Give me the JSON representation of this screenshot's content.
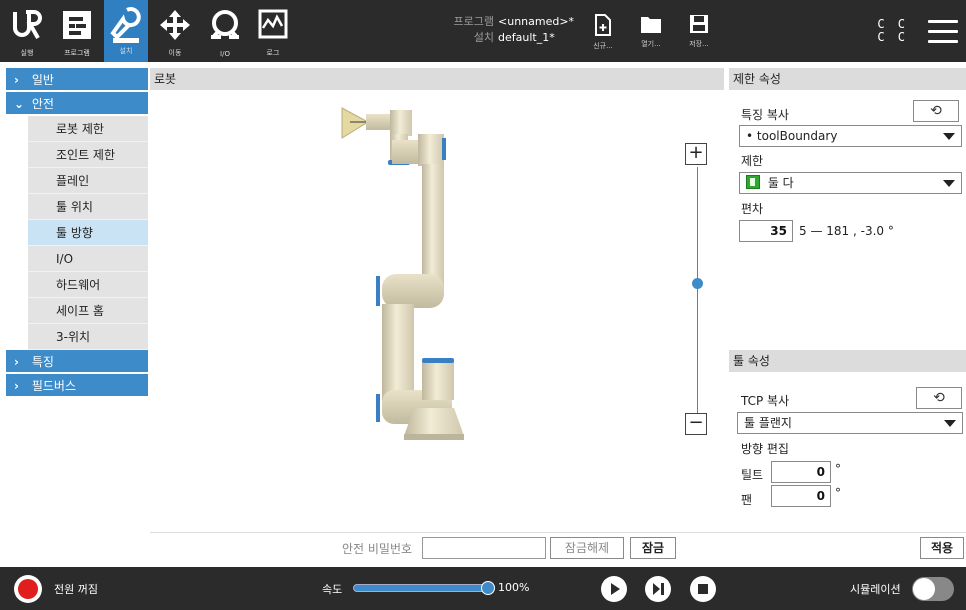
{
  "topbar": {
    "nav": [
      {
        "label": "실행",
        "icon": "ur-logo-icon"
      },
      {
        "label": "프로그램",
        "icon": "program-icon"
      },
      {
        "label": "설치",
        "icon": "installation-icon",
        "active": true
      },
      {
        "label": "이동",
        "icon": "move-icon"
      },
      {
        "label": "I/O",
        "icon": "io-icon"
      },
      {
        "label": "로그",
        "icon": "log-icon"
      }
    ],
    "program_key": "프로그램",
    "program_value": "<unnamed>*",
    "install_key": "설치",
    "install_value": "default_1*",
    "file_buttons": [
      {
        "label": "신규...",
        "icon": "new-file-icon"
      },
      {
        "label": "열기...",
        "icon": "open-folder-icon"
      },
      {
        "label": "저장...",
        "icon": "save-icon"
      }
    ],
    "cc_status": [
      "C C",
      "C C"
    ]
  },
  "sidebar": {
    "general": "일반",
    "safety": "안전",
    "safety_items": [
      "로봇 제한",
      "조인트 제한",
      "플레인",
      "툴 위치",
      "툴 방향",
      "I/O",
      "하드웨어",
      "세이프 홈",
      "3-위치"
    ],
    "selected_item": "툴 방향",
    "features": "특징",
    "fieldbus": "필드버스"
  },
  "robot_panel": {
    "title": "로봇",
    "zoom_in": "+",
    "zoom_out": "−"
  },
  "restriction_panel": {
    "title": "제한 속성",
    "copy_feature_label": "특징 복사",
    "feature_value": "toolBoundary",
    "limit_label": "제한",
    "limit_value": "둘 다",
    "deviation_label": "편차",
    "deviation_value": "35",
    "deviation_range": "5 — 181 , -3.0 °"
  },
  "tool_panel": {
    "title": "툴 속성",
    "tcp_copy_label": "TCP 복사",
    "tcp_value": "툴 플랜지",
    "orientation_label": "방향 편집",
    "tilt_label": "틸트",
    "tilt_value": "0",
    "pan_label": "팬",
    "pan_value": "0",
    "degree": "°"
  },
  "lockbar": {
    "password_label": "안전 비밀번호",
    "password_value": "",
    "unlock_label": "잠금해제",
    "lock_label": "잠금",
    "apply_label": "적용"
  },
  "footer": {
    "power_label": "전원 꺼짐",
    "speed_label": "속도",
    "speed_percent": "100%",
    "speed_fraction": 1.0,
    "simulation_label": "시뮬레이션",
    "simulation_on": false
  },
  "colors": {
    "accent": "#3d8bc9",
    "topbar": "#2b2b2b",
    "power": "#e01e1e",
    "limit_icon": "#2daa2d"
  }
}
